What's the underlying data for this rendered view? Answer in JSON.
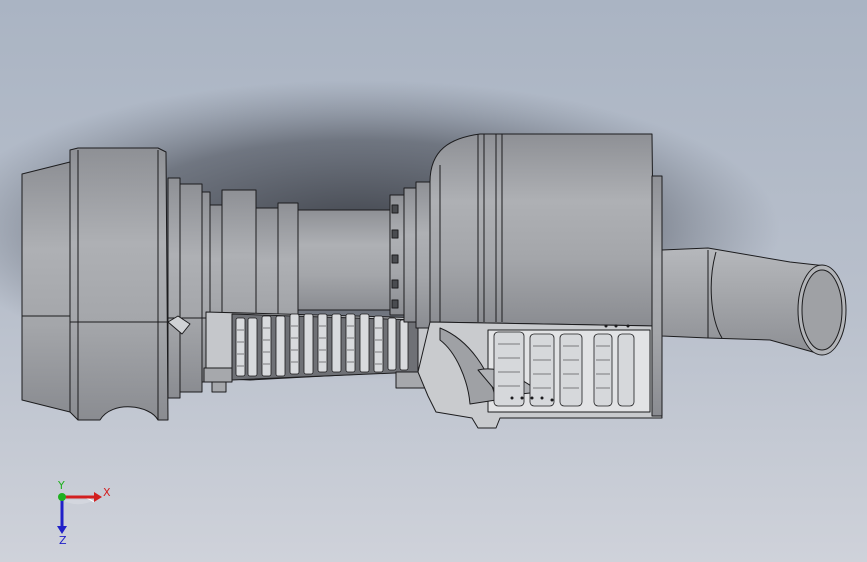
{
  "viewport": {
    "background_top": "#a9b3c2",
    "background_bottom": "#c9cdd6",
    "part_fill": "#a3a5a9",
    "part_dark": "#7c7e83",
    "part_light": "#c0c2c6",
    "cutaway_fill": "#d5d7da",
    "edge_color": "#1c1c1e"
  },
  "triad": {
    "x_label": "X",
    "y_label": "Y",
    "z_label": "Z",
    "x_color": "#d21f1f",
    "y_color": "#1fb01f",
    "z_color": "#2020c8"
  }
}
